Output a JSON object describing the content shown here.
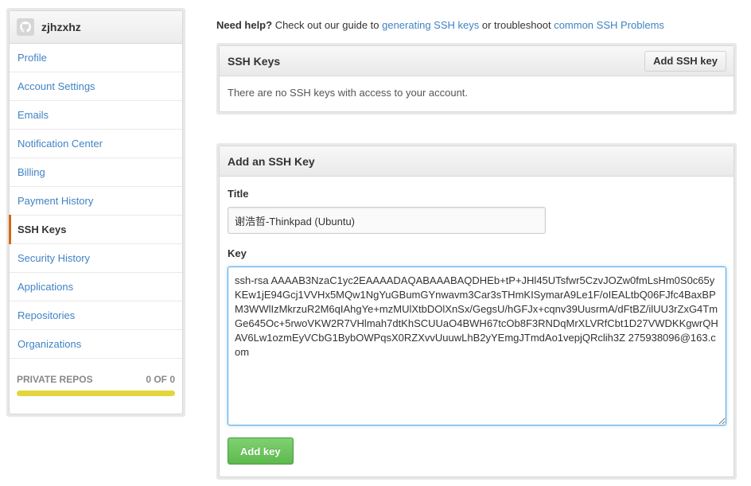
{
  "sidebar": {
    "username": "zjhzxhz",
    "items": [
      {
        "label": "Profile",
        "selected": false
      },
      {
        "label": "Account Settings",
        "selected": false
      },
      {
        "label": "Emails",
        "selected": false
      },
      {
        "label": "Notification Center",
        "selected": false
      },
      {
        "label": "Billing",
        "selected": false
      },
      {
        "label": "Payment History",
        "selected": false
      },
      {
        "label": "SSH Keys",
        "selected": true
      },
      {
        "label": "Security History",
        "selected": false
      },
      {
        "label": "Applications",
        "selected": false
      },
      {
        "label": "Repositories",
        "selected": false
      },
      {
        "label": "Organizations",
        "selected": false
      }
    ],
    "private_repos": {
      "label": "PRIVATE REPOS",
      "count": "0 OF 0",
      "fill_fraction": 1.0,
      "fill_color": "#e4d53a"
    }
  },
  "help": {
    "lead": "Need help?",
    "text1": " Check out our guide to ",
    "link1": "generating SSH keys",
    "text2": " or troubleshoot ",
    "link2": "common SSH Problems"
  },
  "ssh_keys": {
    "title": "SSH Keys",
    "add_button": "Add SSH key",
    "empty_message": "There are no SSH keys with access to your account."
  },
  "add_key": {
    "title": "Add an SSH Key",
    "title_label": "Title",
    "title_value": "谢浩哲-Thinkpad (Ubuntu)",
    "key_label": "Key",
    "key_value": "ssh-rsa AAAAB3NzaC1yc2EAAAADAQABAAABAQDHEb+tP+JHl45UTsfwr5CzvJOZw0fmLsHm0S0c65yKEw1jE94Gcj1VVHx5MQw1NgYuGBumGYnwavm3Car3sTHmKISymarA9Le1F/oIEALtbQ06FJfc4BaxBPM3WWlIzMkrzuR2M6qIAhgYe+mzMUlXtbDOlXnSx/GegsU/hGFJx+cqnv39UusrmA/dFtBZ/ilUU3rZxG4TmGe645Oc+5rwoVKW2R7VHlmah7dtKhSCUUaO4BWH67tcOb8F3RNDqMrXLVRfCbt1D27VWDKKgwrQHAV6Lw1ozmEyVCbG1BybOWPqsX0RZXvvUuuwLhB2yYEmgJTmdAo1vepjQRclih3Z 275938096@163.com",
    "submit_label": "Add key"
  },
  "colors": {
    "link": "#4183c4",
    "selected_marker": "#d26911",
    "primary_button": "#5fb94e",
    "focus_border": "#51a7e8"
  }
}
